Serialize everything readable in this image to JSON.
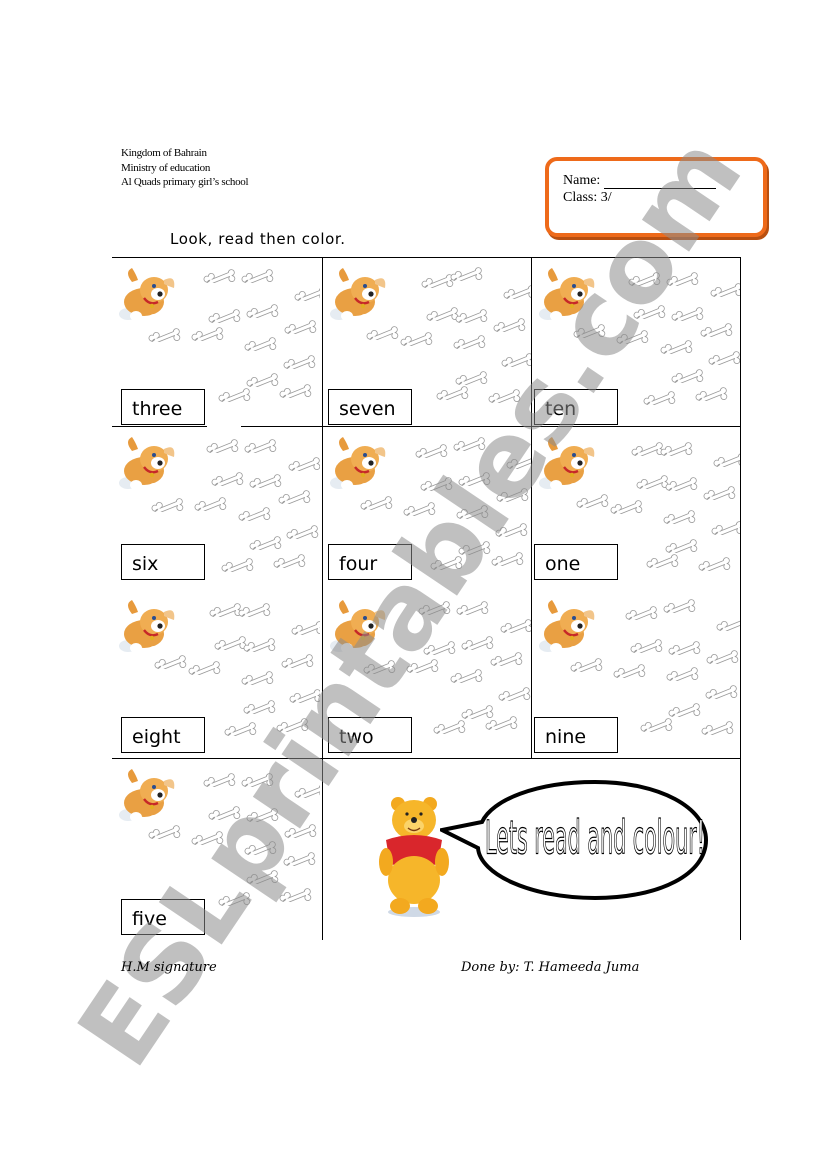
{
  "header": {
    "lines": [
      "Kingdom of Bahrain",
      "Ministry of education",
      "Al Quads primary girl’s school"
    ]
  },
  "name_box": {
    "name_label": "Name:",
    "class_label": "Class: 3/"
  },
  "instruction": "Look, read then color.",
  "cells": [
    {
      "word": "three",
      "icon": "puppy-icon",
      "bones_icon": "bone-icon"
    },
    {
      "word": "seven",
      "icon": "puppy-icon",
      "bones_icon": "bone-icon"
    },
    {
      "word": "ten",
      "icon": "puppy-icon",
      "bones_icon": "bone-icon"
    },
    {
      "word": "six",
      "icon": "puppy-icon",
      "bones_icon": "bone-icon"
    },
    {
      "word": "four",
      "icon": "puppy-icon",
      "bones_icon": "bone-icon"
    },
    {
      "word": "one",
      "icon": "puppy-icon",
      "bones_icon": "bone-icon"
    },
    {
      "word": "eight",
      "icon": "puppy-icon",
      "bones_icon": "bone-icon"
    },
    {
      "word": "two",
      "icon": "puppy-icon",
      "bones_icon": "bone-icon"
    },
    {
      "word": "nine",
      "icon": "puppy-icon",
      "bones_icon": "bone-icon"
    },
    {
      "word": "five",
      "icon": "puppy-icon",
      "bones_icon": "bone-icon"
    }
  ],
  "speech_bubble": {
    "text": "Lets read and colour!",
    "character_icon": "winnie-the-pooh-icon"
  },
  "footer": {
    "left": "H.M signature",
    "right": "Done by: T. Hameeda Juma"
  },
  "watermark": "ESLprintables.com",
  "colors": {
    "name_box_border": "#ee6a1a",
    "watermark": "#8c8c8c"
  }
}
